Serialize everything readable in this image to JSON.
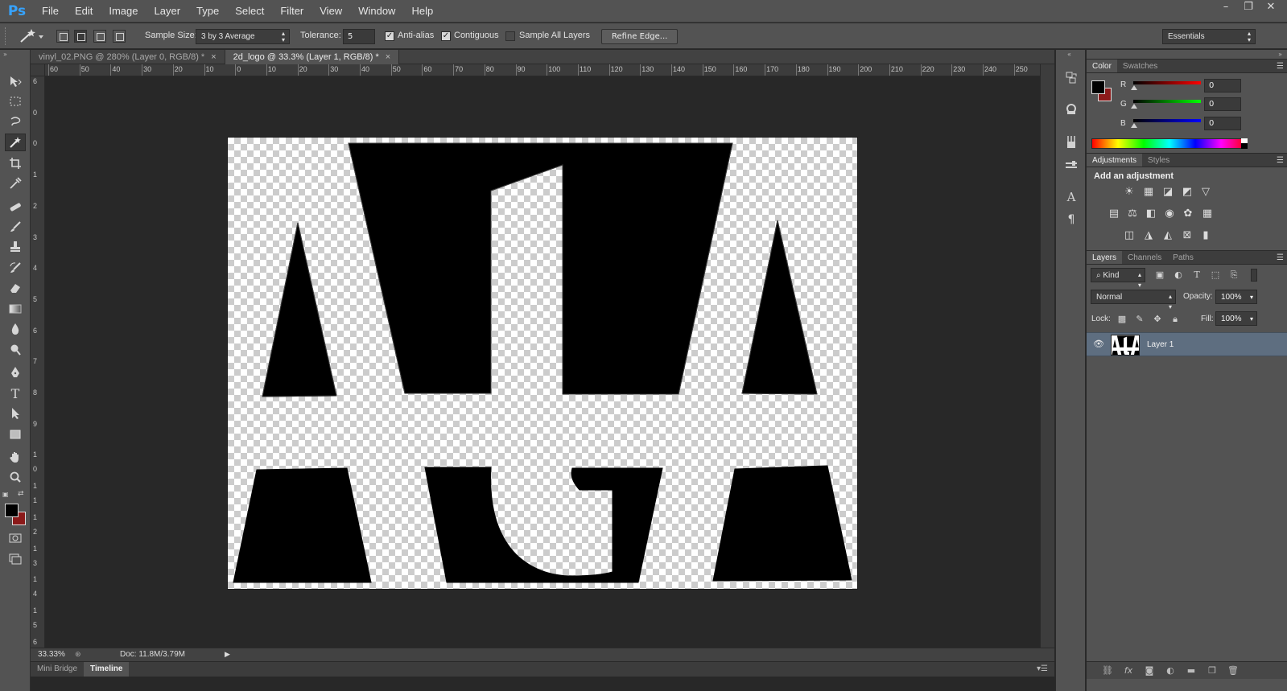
{
  "app": {
    "logo": "Ps"
  },
  "menu": [
    "File",
    "Edit",
    "Image",
    "Layer",
    "Type",
    "Select",
    "Filter",
    "View",
    "Window",
    "Help"
  ],
  "window_controls": {
    "minimize": "–",
    "restore": "❐",
    "close": "✕"
  },
  "options": {
    "sample_size_label": "Sample Size:",
    "sample_size_value": "3 by 3 Average",
    "tolerance_label": "Tolerance:",
    "tolerance_value": "5",
    "anti_alias_label": "Anti-alias",
    "anti_alias_checked": true,
    "contiguous_label": "Contiguous",
    "contiguous_checked": true,
    "sample_all_layers_label": "Sample All Layers",
    "sample_all_layers_checked": false,
    "refine_edge_label": "Refine Edge...",
    "workspace_value": "Essentials"
  },
  "document_tabs": [
    {
      "label": "vinyl_02.PNG @ 280% (Layer 0, RGB/8) *",
      "close": "×",
      "active": false
    },
    {
      "label": "2d_logo @ 33.3% (Layer 1, RGB/8) *",
      "close": "×",
      "active": true
    }
  ],
  "ruler_top": [
    "60",
    "50",
    "40",
    "30",
    "20",
    "10",
    "0",
    "10",
    "20",
    "30",
    "40",
    "50",
    "60",
    "70",
    "80",
    "90",
    "100",
    "110",
    "120",
    "130",
    "140",
    "150",
    "160",
    "170",
    "180",
    "190",
    "200",
    "210",
    "220",
    "230",
    "240",
    "250"
  ],
  "ruler_left": [
    "6",
    "0",
    "0",
    "1",
    "2",
    "3",
    "4",
    "5",
    "6",
    "7",
    "8",
    "9",
    "1 0",
    "1 1",
    "1 2",
    "1 3",
    "1 4",
    "1 5",
    "6"
  ],
  "status": {
    "zoom": "33.33%",
    "doc": "Doc: 11.8M/3.79M"
  },
  "bottom_tabs": [
    {
      "label": "Mini Bridge",
      "active": false
    },
    {
      "label": "Timeline",
      "active": true
    }
  ],
  "color_panel": {
    "tabs": [
      "Color",
      "Swatches"
    ],
    "channels": [
      {
        "label": "R",
        "value": "0",
        "color": "#ff0000"
      },
      {
        "label": "G",
        "value": "0",
        "color": "#00ff00"
      },
      {
        "label": "B",
        "value": "0",
        "color": "#0000ff"
      }
    ],
    "foreground": "#000000",
    "background": "#8b1a1a"
  },
  "adjustments_panel": {
    "tabs": [
      "Adjustments",
      "Styles"
    ],
    "heading": "Add an adjustment"
  },
  "layers_panel": {
    "tabs": [
      "Layers",
      "Channels",
      "Paths"
    ],
    "filter_label": "Kind",
    "blend_mode": "Normal",
    "opacity_label": "Opacity:",
    "opacity_value": "100%",
    "lock_label": "Lock:",
    "fill_label": "Fill:",
    "fill_value": "100%",
    "layers": [
      {
        "name": "Layer 1",
        "visible": true,
        "selected": true
      }
    ]
  }
}
